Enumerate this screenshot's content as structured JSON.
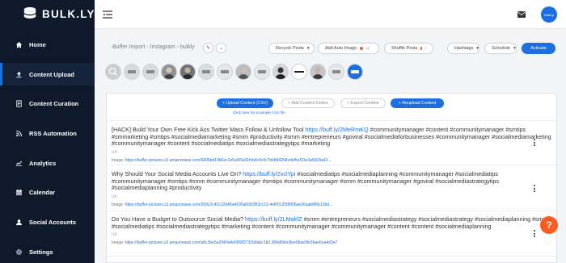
{
  "brand": {
    "name": "BULK.LY"
  },
  "sidebar": {
    "items": [
      {
        "label": "Home",
        "icon": "home-icon"
      },
      {
        "label": "Content Upload",
        "icon": "upload-icon",
        "active": true
      },
      {
        "label": "Content Curation",
        "icon": "document-icon"
      },
      {
        "label": "RSS Automation",
        "icon": "rss-icon"
      },
      {
        "label": "Analytics",
        "icon": "chart-icon"
      },
      {
        "label": "Calendar",
        "icon": "calendar-icon"
      },
      {
        "label": "Social Accounts",
        "icon": "user-icon"
      },
      {
        "label": "Settings",
        "icon": "gear-icon"
      }
    ]
  },
  "topbar": {
    "avatar_text": "Bulk.ly"
  },
  "toolbar": {
    "title": "Buffer Import - Instagram - bulkly",
    "recycle": "Recycle Posts",
    "auto_image": "Add Auto Image",
    "shuffle": "Shuffle Posts",
    "hashtags": "Hashtags",
    "schedule": "Schedule",
    "activate": "Activate"
  },
  "actions": {
    "upload_csv": "+ Upload Content (CSV)",
    "add_online": "+ Add Content Online",
    "export": "+ Export Content",
    "reupload": "+ Reupload Content",
    "sample": "Click here for a sample CSV file"
  },
  "posts": [
    {
      "text_before": "[HACK] Build Your Own Free Kick Ass Twitter Mass Follow & Unfollow Tool ",
      "link": "https://buff.ly/2MeRmKQ",
      "text_after": " #communitymanager #content #communitymanager #smtips #smmarketing #smtips #socialmediamarketing #smm #productivity #smm #entrepreneurs #goviral #socialmediaforbusinesses #communitymanager #socialmediamarketing #communitymanager #content #socialmediatips #socialmediastrategytips  #marketing",
      "url_label": "Url:",
      "image_label": "Image:",
      "image_url": "https://buffer-pictures.s3.amazonaws.com/9406bd13b6ec1e5a5f3a01fcb4c9c0c7bb8d02b8cdef5ef23e3a6d28a43..."
    },
    {
      "text_before": "Why Should Your Social Media Accounts Live On? ",
      "link": "https://buff.ly/2vclYpi",
      "text_after": " #socialmediatips #socialmediaplanning  #communitymanager #socialmediatips #communitymanager #smtips #smm #communitymanager #smtips #communitymanager #smm #communitymanager #goviral #socialmediastrategytips #socialmediaplanning  #productivity",
      "url_label": "Url:",
      "image_label": "Image:",
      "image_url": "https://buffer-pictures.s3.amazonaws.com/399c2c42c22d48a4935ab6b2f83cc19.4ef0012f3f6f08ae36aab8f6b13bd..."
    },
    {
      "text_before": "Do You Have a Budget to Outsource Social Media? ",
      "link": "https://buff.ly/2LMakfZ",
      "text_after": " #smm #entrepreneurs #socialmediastrategy #socialmediastrategy #socialmediaplanning  #smm #socialmediatips #socialmediastrategytips #marketing #content #communitymanager #communitymanager #content #content #socialmediaplanning",
      "url_label": "Url:",
      "image_label": "Image:",
      "image_url": "https://buffer-pictures.s3.amazonaws.com/a8c3be5a2049a4ef389f2731b8abc1b0.36bd6bbc8ee06ae5fe3bae6ea4d3e7"
    }
  ],
  "help": {
    "label": "?"
  },
  "colors": {
    "accent": "#1d6fe0",
    "sidebar": "#0e1a2c",
    "help": "#ff5a1f",
    "auto_image_dot": "#ff5a1f",
    "shuffle_dot": "#ff5a1f"
  }
}
